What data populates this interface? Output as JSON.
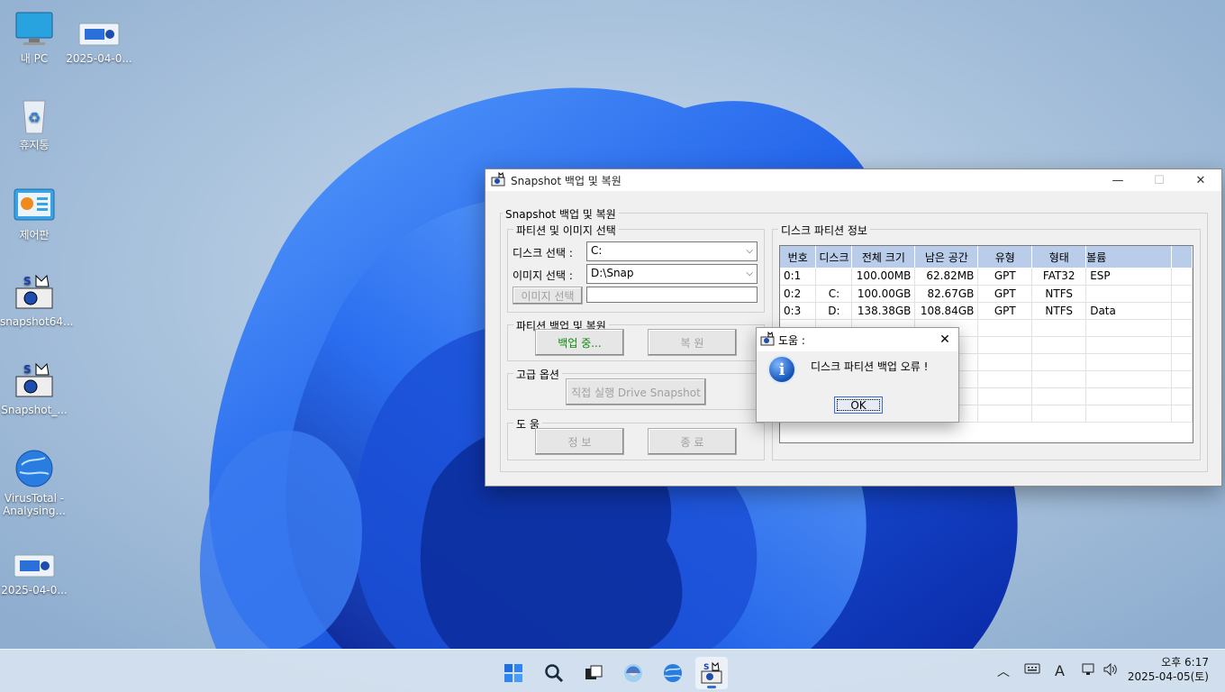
{
  "desktop": {
    "icons": [
      {
        "label": "내 PC",
        "icon": "monitor-icon"
      },
      {
        "label": "2025-04-0...",
        "icon": "snapshot-image-icon"
      },
      {
        "label": "휴지통",
        "icon": "recycle-bin-icon"
      },
      {
        "label": "제어판",
        "icon": "control-panel-icon"
      },
      {
        "label": "snapshot64...",
        "icon": "snapshot-app-icon"
      },
      {
        "label": "Snapshot_...",
        "icon": "snapshot-app-icon"
      },
      {
        "label": "VirusTotal - Analysing...",
        "icon": "globe-icon"
      },
      {
        "label": "2025-04-0...",
        "icon": "snapshot-image-icon"
      }
    ]
  },
  "window": {
    "title": "Snapshot 백업 및 복원",
    "group_main": "Snapshot 백업 및 복원",
    "group_select": "파티션 및 이미지 선택",
    "disk_label": "디스크 선택 :",
    "disk_value": "C:",
    "image_label": "이미지 선택 :",
    "image_value": "D:\\Snap",
    "image_select_button": "이미지 선택",
    "image_path_value": "",
    "group_backup": "파티션 백업 및 복원",
    "backup_button": "백업 중...",
    "restore_button": "복      원",
    "group_advanced": "고급 옵션",
    "direct_run_button": "직접 실행 Drive Snapshot",
    "group_help": "도   움",
    "info_button": "정      보",
    "exit_button": "종      료",
    "group_partition_info": "디스크 파티션 정보",
    "table": {
      "headers": [
        "번호",
        "디스크",
        "전체 크기",
        "남은 공간",
        "유형",
        "형태",
        "볼륨"
      ],
      "rows": [
        [
          "0:1",
          "",
          "100.00MB",
          "62.82MB",
          "GPT",
          "FAT32",
          "ESP"
        ],
        [
          "0:2",
          "C:",
          "100.00GB",
          "82.67GB",
          "GPT",
          "NTFS",
          ""
        ],
        [
          "0:3",
          "D:",
          "138.38GB",
          "108.84GB",
          "GPT",
          "NTFS",
          "Data"
        ]
      ]
    }
  },
  "dialog": {
    "title": "도움 :",
    "message": "디스크 파티션 백업 오류 !",
    "ok_button": "OK"
  },
  "taskbar": {
    "time": "오후 6:17",
    "date": "2025-04-05(토)",
    "ime": "A"
  },
  "colors": {
    "accent": "#2e6fcf",
    "table_header": "#b9cdea",
    "green_text": "#0a8a0a"
  }
}
